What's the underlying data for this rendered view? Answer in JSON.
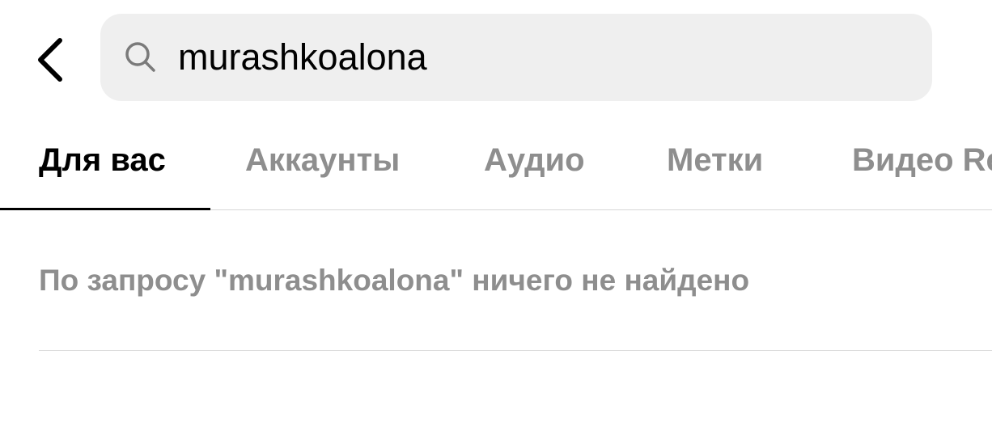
{
  "search": {
    "value": "murashkoalona"
  },
  "tabs": [
    {
      "label": "Для вас",
      "active": true
    },
    {
      "label": "Аккаунты",
      "active": false
    },
    {
      "label": "Аудио",
      "active": false
    },
    {
      "label": "Метки",
      "active": false
    },
    {
      "label": "Видео Re",
      "active": false
    }
  ],
  "results": {
    "empty_message": "По запросу \"murashkoalona\" ничего не найдено"
  },
  "icons": {
    "back": "chevron-left-icon",
    "search": "search-icon"
  },
  "colors": {
    "search_bg": "#efefef",
    "inactive_text": "#8e8e8e",
    "active_text": "#000000",
    "divider": "#dbdbdb"
  }
}
